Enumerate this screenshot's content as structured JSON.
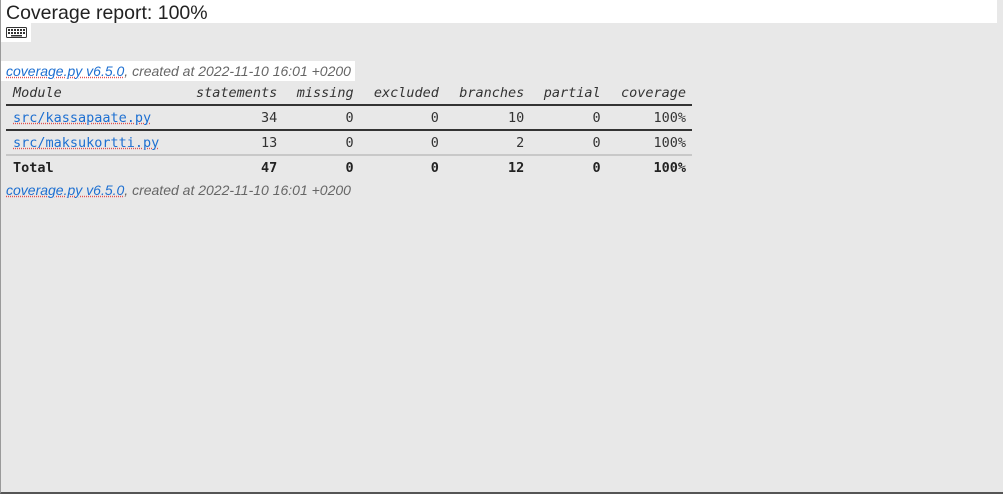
{
  "header": {
    "title": "Coverage report: 100%",
    "keyboard_icon": "keyboard-icon"
  },
  "meta": {
    "tool_link": "coverage.py v6.5.0",
    "created_text": ", created at 2022-11-10 16:01 +0200"
  },
  "table": {
    "columns": [
      "Module",
      "statements",
      "missing",
      "excluded",
      "branches",
      "partial",
      "coverage"
    ],
    "rows": [
      {
        "module": "src/kassapaate.py",
        "statements": "34",
        "missing": "0",
        "excluded": "0",
        "branches": "10",
        "partial": "0",
        "coverage": "100%"
      },
      {
        "module": "src/maksukortti.py",
        "statements": "13",
        "missing": "0",
        "excluded": "0",
        "branches": "2",
        "partial": "0",
        "coverage": "100%"
      }
    ],
    "total": {
      "label": "Total",
      "statements": "47",
      "missing": "0",
      "excluded": "0",
      "branches": "12",
      "partial": "0",
      "coverage": "100%"
    }
  },
  "colors": {
    "background": "#e8e8e8",
    "link": "#1d6fd1",
    "meta_text": "#666666"
  }
}
